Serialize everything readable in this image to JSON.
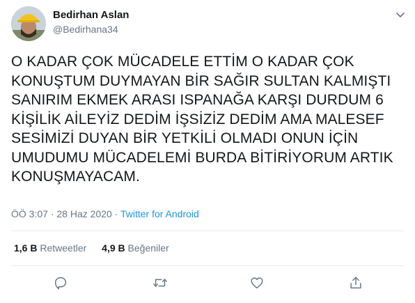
{
  "author": {
    "name": "Bedirhan Aslan",
    "handle": "@Bedirhana34"
  },
  "tweet": {
    "text": "O KADAR ÇOK MÜCADELE ETTİM O KADAR ÇOK\nKONUŞTUM DUYMAYAN BİR SAĞIR SULTAN KALMIŞTI\nSANIRIM EKMEK ARASI ISPANAĞA KARŞI DURDUM 6\nKİŞİLİK AİLEYİZ DEDİM İŞSİZİZ DEDİM AMA MALESEF\nSESİMİZİ DUYAN BİR YETKİLİ OLMADI ONUN İÇİN\nUMUDUMU MÜCADELEMİ BURDA BİTİRİYORUM ARTIK\nKONUŞMAYACAM."
  },
  "meta": {
    "time": "ÖÖ 3:07",
    "separator": "·",
    "date": "28 Haz 2020",
    "source": "Twitter for Android"
  },
  "stats": {
    "retweets_count": "1,6 B",
    "retweets_label": "Retweetler",
    "likes_count": "4,9 B",
    "likes_label": "Beğeniler"
  },
  "icons": {
    "more": "chevron-down-icon",
    "reply": "reply-icon",
    "retweet": "retweet-icon",
    "like": "heart-icon",
    "share": "share-icon"
  },
  "colors": {
    "text": "#14171a",
    "secondary": "#657786",
    "link": "#1b95e0",
    "divider": "#e6ecf0"
  }
}
